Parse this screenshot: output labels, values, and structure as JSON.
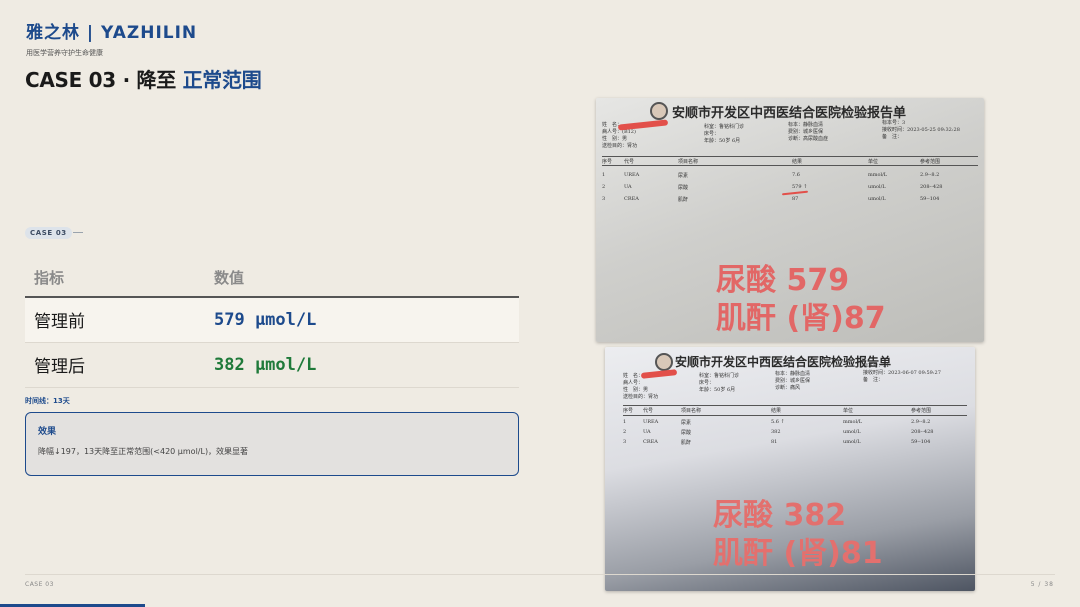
{
  "brand": "雅之林 | YAZHILIN",
  "tagline": "用医学营养守护生命健康",
  "title": {
    "prefix": "CASE 03 · 降至 ",
    "highlight": "正常范围"
  },
  "case_badge": "CASE 03",
  "table": {
    "headers": [
      "指标",
      "数值"
    ],
    "rows": [
      {
        "label": "管理前",
        "value": "579 μmol/L",
        "color": "#1d4a8c"
      },
      {
        "label": "管理后",
        "value": "382 μmol/L",
        "color": "#1f7a3a"
      }
    ]
  },
  "timeline": "时间线：13天",
  "effect": {
    "title": "效果",
    "text": "降幅↓197，13天降至正常范围(<420 μmol/L)，效果显著"
  },
  "report1": {
    "title": "安顺市开发区中西医结合医院检验报告单",
    "overlay_line1": "尿酸 579",
    "overlay_line2": "肌酐 (肾)87",
    "meta_left": [
      "姓　名：",
      "病人号：(B12)",
      "性　别：男",
      "送检目的：肾功"
    ],
    "meta_mid": [
      "科室：鲁铭科门诊",
      "床号：",
      "年龄：50岁 6月"
    ],
    "meta_right": [
      "标本：静脉血清",
      "费别：城乡医保",
      "诊断：高尿酸血症"
    ],
    "meta_far": [
      "标本号：3",
      "接收时间：2023-05-25 09:32:28",
      "备　注："
    ],
    "columns": [
      "序号",
      "代号",
      "项目名称",
      "结果",
      "单位",
      "参考范围"
    ],
    "rows": [
      [
        "1",
        "UREA",
        "尿素",
        "7.6",
        "mmol/L",
        "2.9--8.2"
      ],
      [
        "2",
        "UA",
        "尿酸",
        "579 ↑",
        "umol/L",
        "208--428"
      ],
      [
        "3",
        "CREA",
        "肌酐",
        "87",
        "umol/L",
        "59--104"
      ]
    ]
  },
  "report2": {
    "title": "安顺市开发区中西医结合医院检验报告单",
    "overlay_line1": "尿酸 382",
    "overlay_line2": "肌酐 (肾)81",
    "meta_left": [
      "姓　名：",
      "病人号：",
      "性　别：男",
      "送检目的：肾功"
    ],
    "meta_mid": [
      "科室：鲁铭科门诊",
      "床号：",
      "年龄：50岁 6月"
    ],
    "meta_right": [
      "标本：静脉血清",
      "费别：城乡医保",
      "诊断：痛风"
    ],
    "meta_far": [
      "标本号：21",
      "接收时间：2023-06-07 09:59:27",
      "备　注："
    ],
    "columns": [
      "序号",
      "代号",
      "项目名称",
      "结果",
      "单位",
      "参考范围"
    ],
    "rows": [
      [
        "1",
        "UREA",
        "尿素",
        "5.6 ↑",
        "mmol/L",
        "2.9--8.2"
      ],
      [
        "2",
        "UA",
        "尿酸",
        "382",
        "umol/L",
        "208--428"
      ],
      [
        "3",
        "CREA",
        "肌酐",
        "81",
        "umol/L",
        "59--104"
      ]
    ]
  },
  "footer": {
    "left": "CASE 03",
    "right": "5 / 38"
  },
  "progress": {
    "value": 0.134,
    "color": "#1d4a8c"
  }
}
